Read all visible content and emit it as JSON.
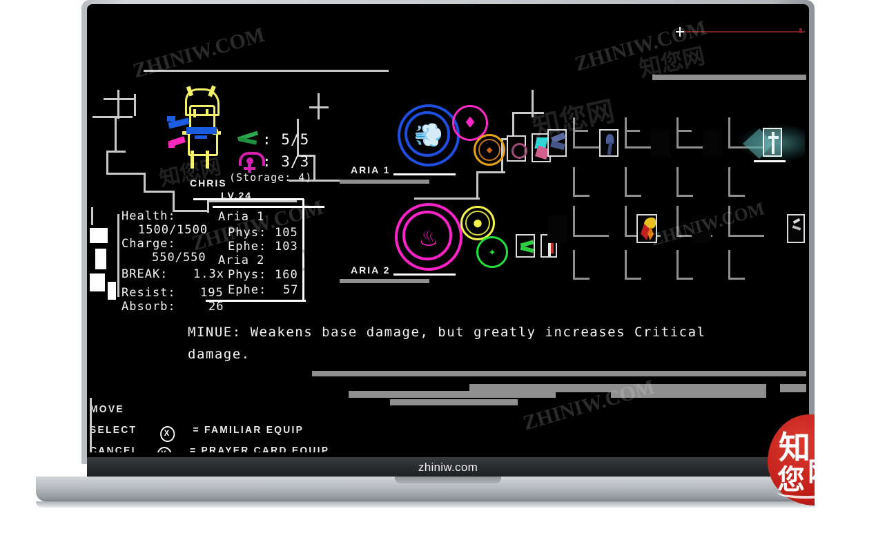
{
  "device": {
    "bottom_bezel_label": "zhiniw.com"
  },
  "watermarks": {
    "latin": "ZHINIW.COM",
    "chinese": "知您网",
    "seal_chars": [
      "知",
      "您",
      "网"
    ]
  },
  "game": {
    "character": {
      "name": "CHRIS",
      "level_label": "LV.24",
      "familiar_counter": ": 5/5",
      "prayer_counter": ": 3/3",
      "storage_label": "(Storage: 4)"
    },
    "stats_left": [
      {
        "label": "Health:",
        "value": "1500/1500"
      },
      {
        "label": "Charge:",
        "value": "550/550"
      },
      {
        "label": "BREAK:",
        "value": "1.3x"
      },
      {
        "label": "Resist:",
        "value": "195"
      },
      {
        "label": "Absorb:",
        "value": "26"
      }
    ],
    "aria_blocks": [
      {
        "title": "Aria 1",
        "rows": [
          {
            "label": "Phys:",
            "value": "105"
          },
          {
            "label": "Ephe:",
            "value": "103"
          }
        ]
      },
      {
        "title": "Aria 2",
        "rows": [
          {
            "label": "Phys:",
            "value": "160"
          },
          {
            "label": "Ephe:",
            "value": "57"
          }
        ]
      }
    ],
    "aria_slot_labels": {
      "row1": "ARIA 1",
      "row2": "ARIA 2"
    },
    "description": {
      "line1": "MINUE: Weakens base damage, but greatly increases Critical",
      "line2": "damage."
    },
    "controls": [
      {
        "action": "MOVE",
        "button": "",
        "assign": ""
      },
      {
        "action": "SELECT",
        "button": "X",
        "assign": "= FAMILIAR EQUIP"
      },
      {
        "action": "CANCEL",
        "button": "Y",
        "assign": "= PRAYER CARD EQUIP"
      }
    ],
    "colors": {
      "aria1_primary": "#1f4fe0",
      "aria1_secondary": "#ff28c8",
      "aria1_tertiary": "#e8a317",
      "aria2_primary": "#ff22c8",
      "aria2_secondary": "#f2f24a",
      "aria2_tertiary": "#22e03c",
      "sprite_outline": "#f5f06a",
      "sprite_sash": "#1b5ce0",
      "sprite_accent": "#ff29c0",
      "hud_line": "#c9c9c9",
      "selection_glow": "#4e9e9e",
      "cursor_line": "#7a2020"
    }
  }
}
